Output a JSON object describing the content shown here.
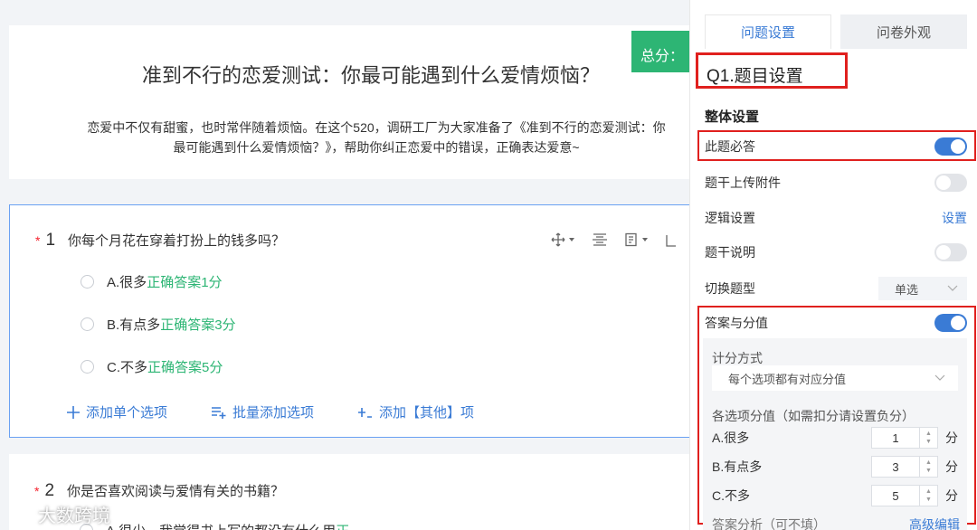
{
  "survey": {
    "title": "准到不行的恋爱测试：你最可能遇到什么爱情烦恼？",
    "desc_line1": "恋爱中不仅有甜蜜，也时常伴随着烦恼。在这个520，调研工厂为大家准备了《准到不行的恋爱测试：你",
    "desc_line2": "最可能遇到什么爱情烦恼？》，帮助你纠正恋爱中的错误，正确表达爱意~",
    "total_score_label": "总分："
  },
  "question1": {
    "required_mark": "*",
    "number": "1",
    "text": "你每个月花在穿着打扮上的钱多吗？",
    "options": [
      {
        "label": "A.很多",
        "answer": "正确答案1分"
      },
      {
        "label": "B.有点多",
        "answer": "正确答案3分"
      },
      {
        "label": "C.不多",
        "answer": "正确答案5分"
      }
    ],
    "actions": {
      "add_single": "添加单个选项",
      "batch_add": "批量添加选项",
      "add_other": "添加【其他】项"
    }
  },
  "question2": {
    "required_mark": "*",
    "number": "2",
    "text": "你是否喜欢阅读与爱情有关的书籍？",
    "first_option": "A.很少，我觉得书上写的都没有什么用",
    "first_option_answer": "正"
  },
  "watermark": "大数跨境",
  "panel": {
    "tab_active": "问题设置",
    "tab_inactive": "问卷外观",
    "title": "Q1.题目设置",
    "section_title": "整体设置",
    "rows": {
      "required": "此题必答",
      "attachment": "题干上传附件",
      "logic": "逻辑设置",
      "logic_link": "设置",
      "description": "题干说明",
      "switch_type": "切换题型",
      "switch_type_value": "单选",
      "score": "答案与分值"
    },
    "score_area": {
      "method_label": "计分方式",
      "method_value": "每个选项都有对应分值",
      "values_label": "各选项分值（如需扣分请设置负分）",
      "items": [
        {
          "name": "A.很多",
          "value": "1",
          "unit": "分"
        },
        {
          "name": "B.有点多",
          "value": "3",
          "unit": "分"
        },
        {
          "name": "C.不多",
          "value": "5",
          "unit": "分"
        }
      ],
      "analysis_label": "答案分析（可不填）",
      "advanced_edit": "高级编辑"
    }
  },
  "colors": {
    "accent": "#3a7bd5",
    "answer_green": "#2db574",
    "highlight_red": "#e0201e"
  }
}
